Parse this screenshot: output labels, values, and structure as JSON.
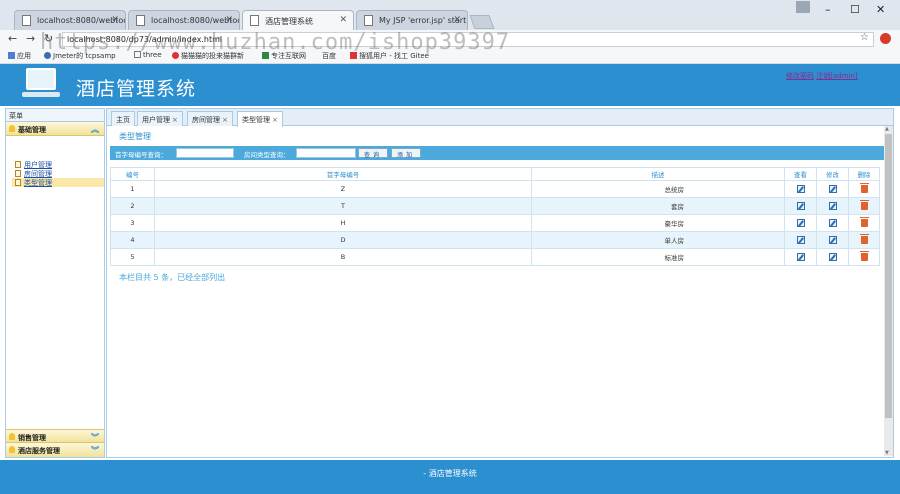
{
  "browser": {
    "tabs": [
      {
        "title": "localhost:8080/webtoo",
        "active": false
      },
      {
        "title": "localhost:8080/webtoo",
        "active": false
      },
      {
        "title": "酒店管理系统",
        "active": true
      },
      {
        "title": "My JSP 'error.jsp' starti",
        "active": false
      }
    ],
    "url": "localhost:8080/dp73/admin/index.html",
    "bookmarks": [
      "应用",
      "Jmeter的 tcpsamp",
      "three",
      "猫猫猫的投来猫群新",
      "专注互联网",
      "百度",
      "搜狐用户 - 找工 Gitee"
    ],
    "watermark": "https://www.huzhan.com/ishop39397"
  },
  "header": {
    "title": "酒店管理系统",
    "link_password": "修改密码",
    "link_logout": "注销[admin]"
  },
  "sidebar": {
    "title": "菜单",
    "groups": [
      {
        "label": "基础管理",
        "items": [
          "用户管理",
          "房间管理",
          "类型管理"
        ],
        "selected": 2
      },
      {
        "label": "销售管理"
      },
      {
        "label": "酒店服务管理"
      }
    ]
  },
  "content_tabs": [
    {
      "label": "主页",
      "closable": false
    },
    {
      "label": "用户管理",
      "closable": true
    },
    {
      "label": "房间管理",
      "closable": true
    },
    {
      "label": "类型管理",
      "closable": true,
      "active": true
    }
  ],
  "page": {
    "title": "类型管理",
    "search": {
      "label1": "首字母编号查询：",
      "value1": "",
      "label2": "房间类型查询：",
      "value2": "",
      "search_button": "查询",
      "add_button": "添加"
    },
    "table": {
      "headers": [
        "编号",
        "首字母编号",
        "描述",
        "查看",
        "修改",
        "删除"
      ],
      "rows": [
        [
          "1",
          "Z",
          "总统房"
        ],
        [
          "2",
          "T",
          "套房"
        ],
        [
          "3",
          "H",
          "豪华房"
        ],
        [
          "4",
          "D",
          "单人房"
        ],
        [
          "5",
          "B",
          "标准房"
        ]
      ]
    },
    "summary": "本栏目共 5 条，已经全部列出"
  },
  "footer": {
    "text": "- 酒店管理系统"
  },
  "colors": {
    "primary": "#2c8fd0",
    "search_bar": "#4ba9dc",
    "row_alt": "#e7f4fc",
    "menu_group": "#f2e29a",
    "delete_icon": "#e0622f"
  }
}
